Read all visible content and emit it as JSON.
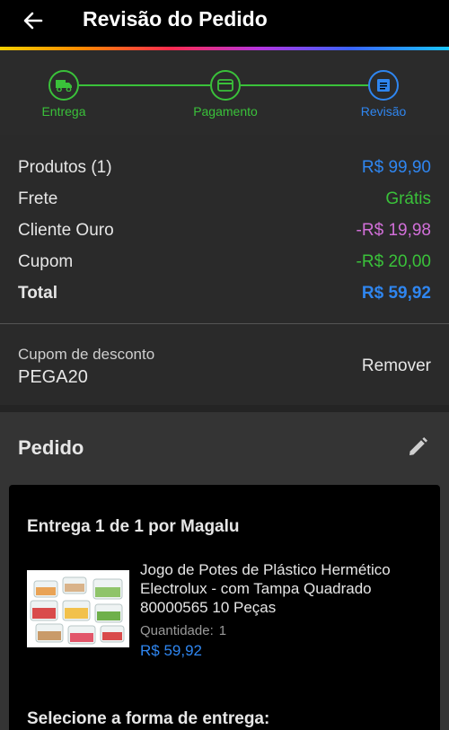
{
  "header": {
    "title": "Revisão do Pedido"
  },
  "stepper": {
    "steps": [
      {
        "label": "Entrega",
        "icon": "truck-icon",
        "state": "done"
      },
      {
        "label": "Pagamento",
        "icon": "card-icon",
        "state": "done"
      },
      {
        "label": "Revisão",
        "icon": "document-icon",
        "state": "active"
      }
    ]
  },
  "summary": {
    "rows": [
      {
        "label": "Produtos (1)",
        "value": "R$ 99,90",
        "color": "#2f86f0"
      },
      {
        "label": "Frete",
        "value": "Grátis",
        "color": "#3ac13a"
      },
      {
        "label": "Cliente Ouro",
        "value": "-R$ 19,98",
        "color": "#d16fd8"
      },
      {
        "label": "Cupom",
        "value": "-R$ 20,00",
        "color": "#3ac13a"
      },
      {
        "label": "Total",
        "value": "R$ 59,92",
        "color": "#2f86f0"
      }
    ]
  },
  "coupon": {
    "label": "Cupom de desconto",
    "code": "PEGA20",
    "remove_label": "Remover"
  },
  "pedido": {
    "title": "Pedido",
    "delivery_title": "Entrega 1 de 1 por Magalu",
    "product": {
      "name": "Jogo de Potes de Plástico Hermético Electrolux - com Tampa Quadrado 80000565 10 Peças",
      "quantity_label": "Quantidade:",
      "quantity": "1",
      "price": "R$ 59,92"
    },
    "shipping_title": "Selecione a forma de entrega:"
  },
  "colors": {
    "accent_blue": "#2f86f0",
    "accent_green": "#3ac13a",
    "accent_pink": "#d16fd8"
  }
}
